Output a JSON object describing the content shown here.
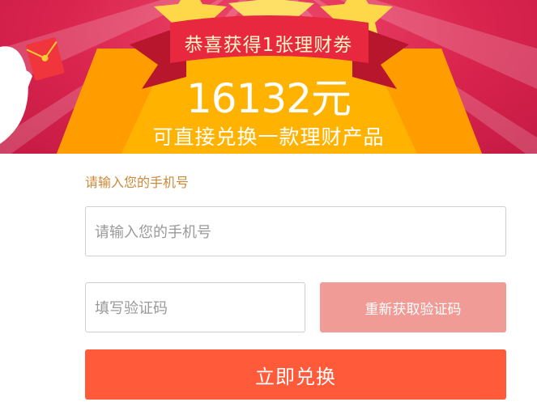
{
  "banner": {
    "title": "恭喜获得1张理财劵",
    "amount": "16132元",
    "subtitle": "可直接兑换一款理财产品"
  },
  "form": {
    "phone_label": "请输入您的手机号",
    "phone_placeholder": "请输入您的手机号",
    "code_placeholder": "填写验证码",
    "resend_label": "重新获取验证码",
    "submit_label": "立即兑换"
  },
  "colors": {
    "banner_red": "#d9244e",
    "gold": "#ffb300",
    "ribbon": "#e8283f",
    "label": "#c98a3b",
    "resend_bg": "#f09b95",
    "submit_bg": "#ff5b3a"
  },
  "icons": [
    "star-icon",
    "red-envelope-icon",
    "mascot-icon"
  ]
}
